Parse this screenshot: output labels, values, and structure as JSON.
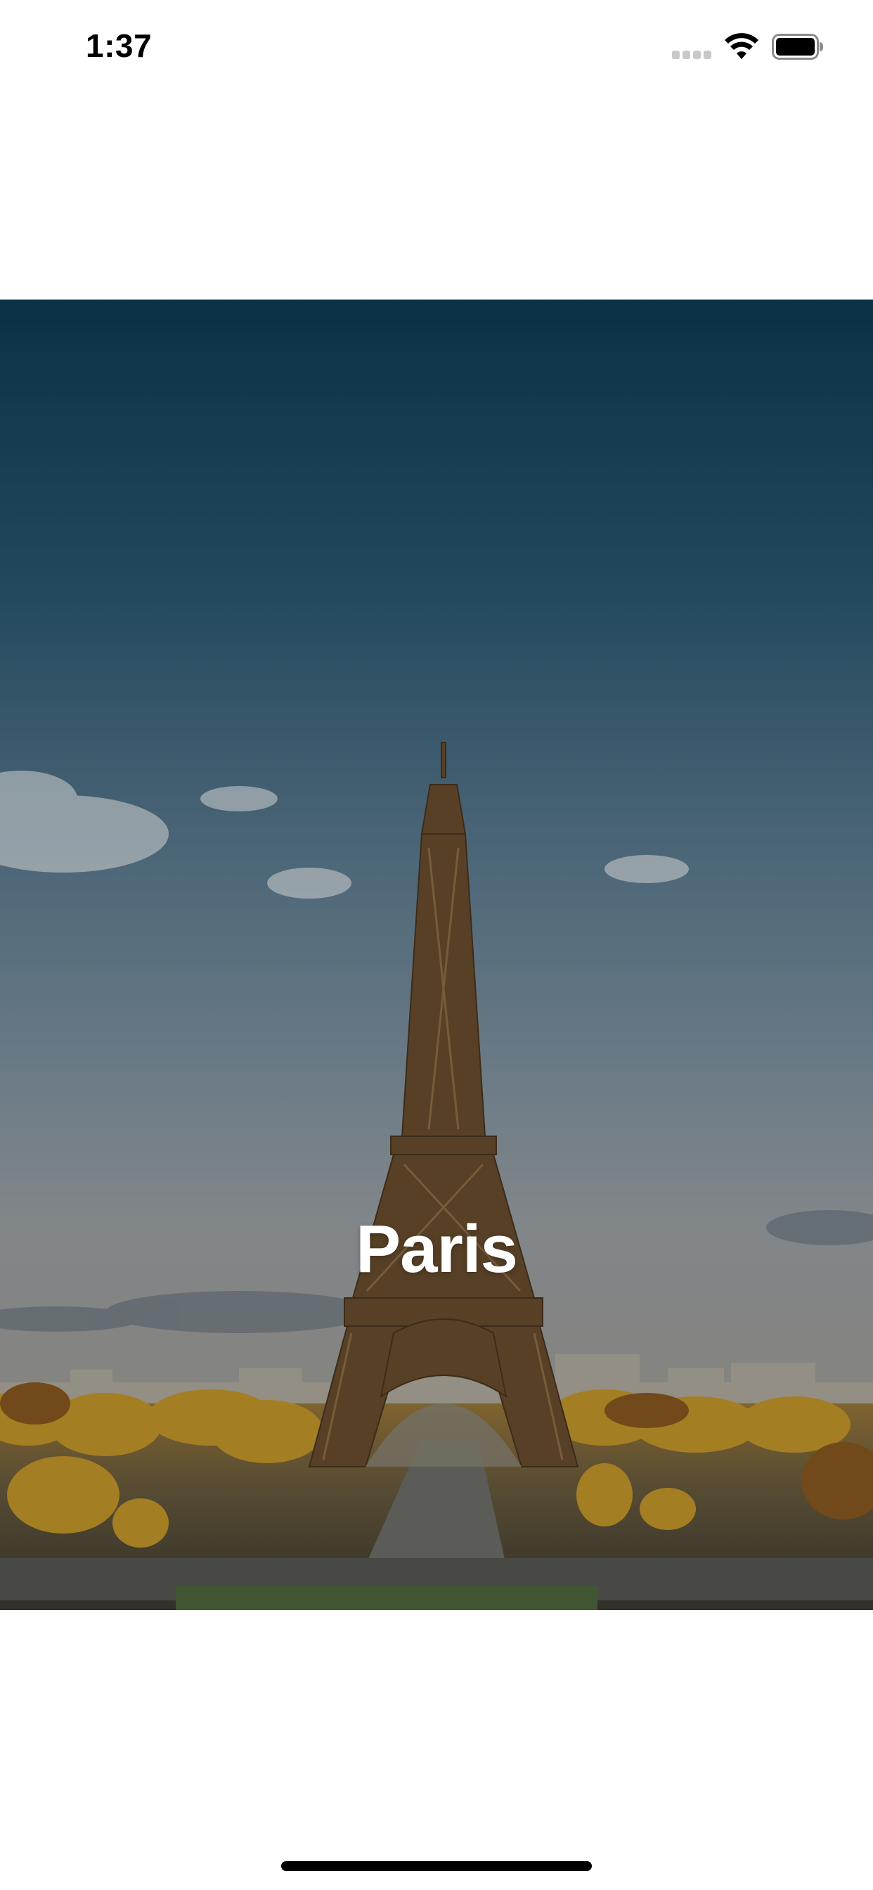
{
  "status_bar": {
    "time": "1:37",
    "signal_icon": "cellular-signal-icon",
    "wifi_icon": "wifi-icon",
    "battery_icon": "battery-full-icon"
  },
  "hero": {
    "title": "Paris",
    "image": "eiffel-tower-photo",
    "overlay_color": "#000000"
  },
  "home_indicator": {
    "icon": "home-indicator-bar"
  }
}
